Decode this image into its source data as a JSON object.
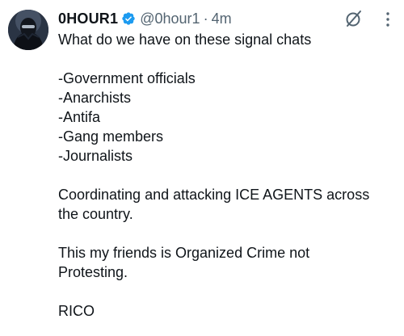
{
  "author": {
    "display_name": "0HOUR1",
    "handle": "@0hour1",
    "separator": "·",
    "time": "4m"
  },
  "icons": {
    "avatar": "masked-figure-avatar",
    "verified": "verified-badge-icon",
    "grok": "grok-icon",
    "more": "more-dots-icon"
  },
  "colors": {
    "verified": "#1d9bf0",
    "text": "#0f1419",
    "secondary": "#536471"
  },
  "tweet": {
    "line1": "What do we have on these signal chats",
    "list": [
      "-Government officials",
      "-Anarchists",
      "-Antifa",
      "-Gang members",
      "-Journalists"
    ],
    "para2_line1": "Coordinating and attacking ICE AGENTS across",
    "para2_line2": "the country.",
    "para3_line1": "This my friends is Organized Crime not",
    "para3_line2": "Protesting.",
    "para4": "RICO"
  }
}
